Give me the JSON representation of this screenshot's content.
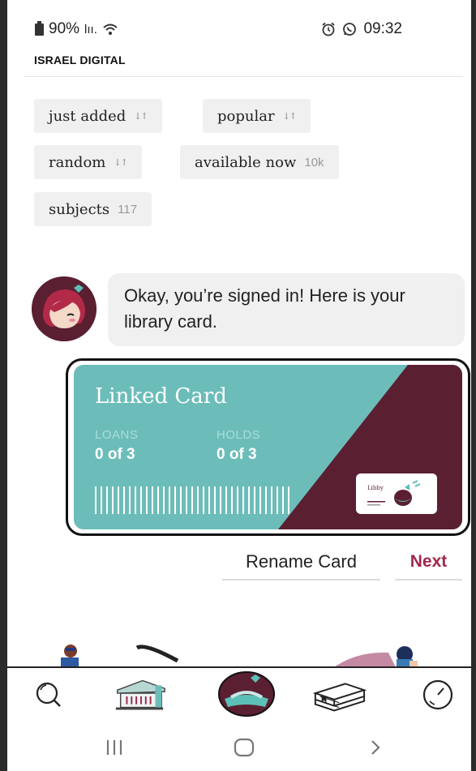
{
  "status_bar": {
    "battery": "90%",
    "signal": "lıı.",
    "time": "09:32"
  },
  "library": {
    "name": "ISRAEL DIGITAL"
  },
  "filters": [
    {
      "label": "just added",
      "sort_icon": "↓↑"
    },
    {
      "label": "popular",
      "sort_icon": "↓↑"
    },
    {
      "label": "random",
      "sort_icon": "↓↑"
    },
    {
      "label": "available now",
      "count": "10k"
    },
    {
      "label": "subjects",
      "count": "117"
    }
  ],
  "message": {
    "text": "Okay, you’re signed in! Here is your library card."
  },
  "card": {
    "title": "Linked Card",
    "loans_label": "LOANS",
    "loans_value": "0 of 3",
    "holds_label": "HOLDS",
    "holds_value": "0 of 3",
    "logo_text": "Libby",
    "colors": {
      "teal": "#6cbdb9",
      "maroon": "#5b1f32"
    }
  },
  "actions": {
    "rename_label": "Rename Card",
    "next_label": "Next"
  },
  "bottom_nav": [
    {
      "icon": "search-icon"
    },
    {
      "icon": "library-icon"
    },
    {
      "icon": "libby-home-icon"
    },
    {
      "icon": "shelf-icon"
    },
    {
      "icon": "timeline-icon"
    }
  ],
  "system_nav": [
    {
      "icon": "recent-apps-icon"
    },
    {
      "icon": "home-icon"
    },
    {
      "icon": "back-icon"
    }
  ],
  "colors": {
    "accent": "#a0294b",
    "chip_bg": "#f0f0f0"
  }
}
